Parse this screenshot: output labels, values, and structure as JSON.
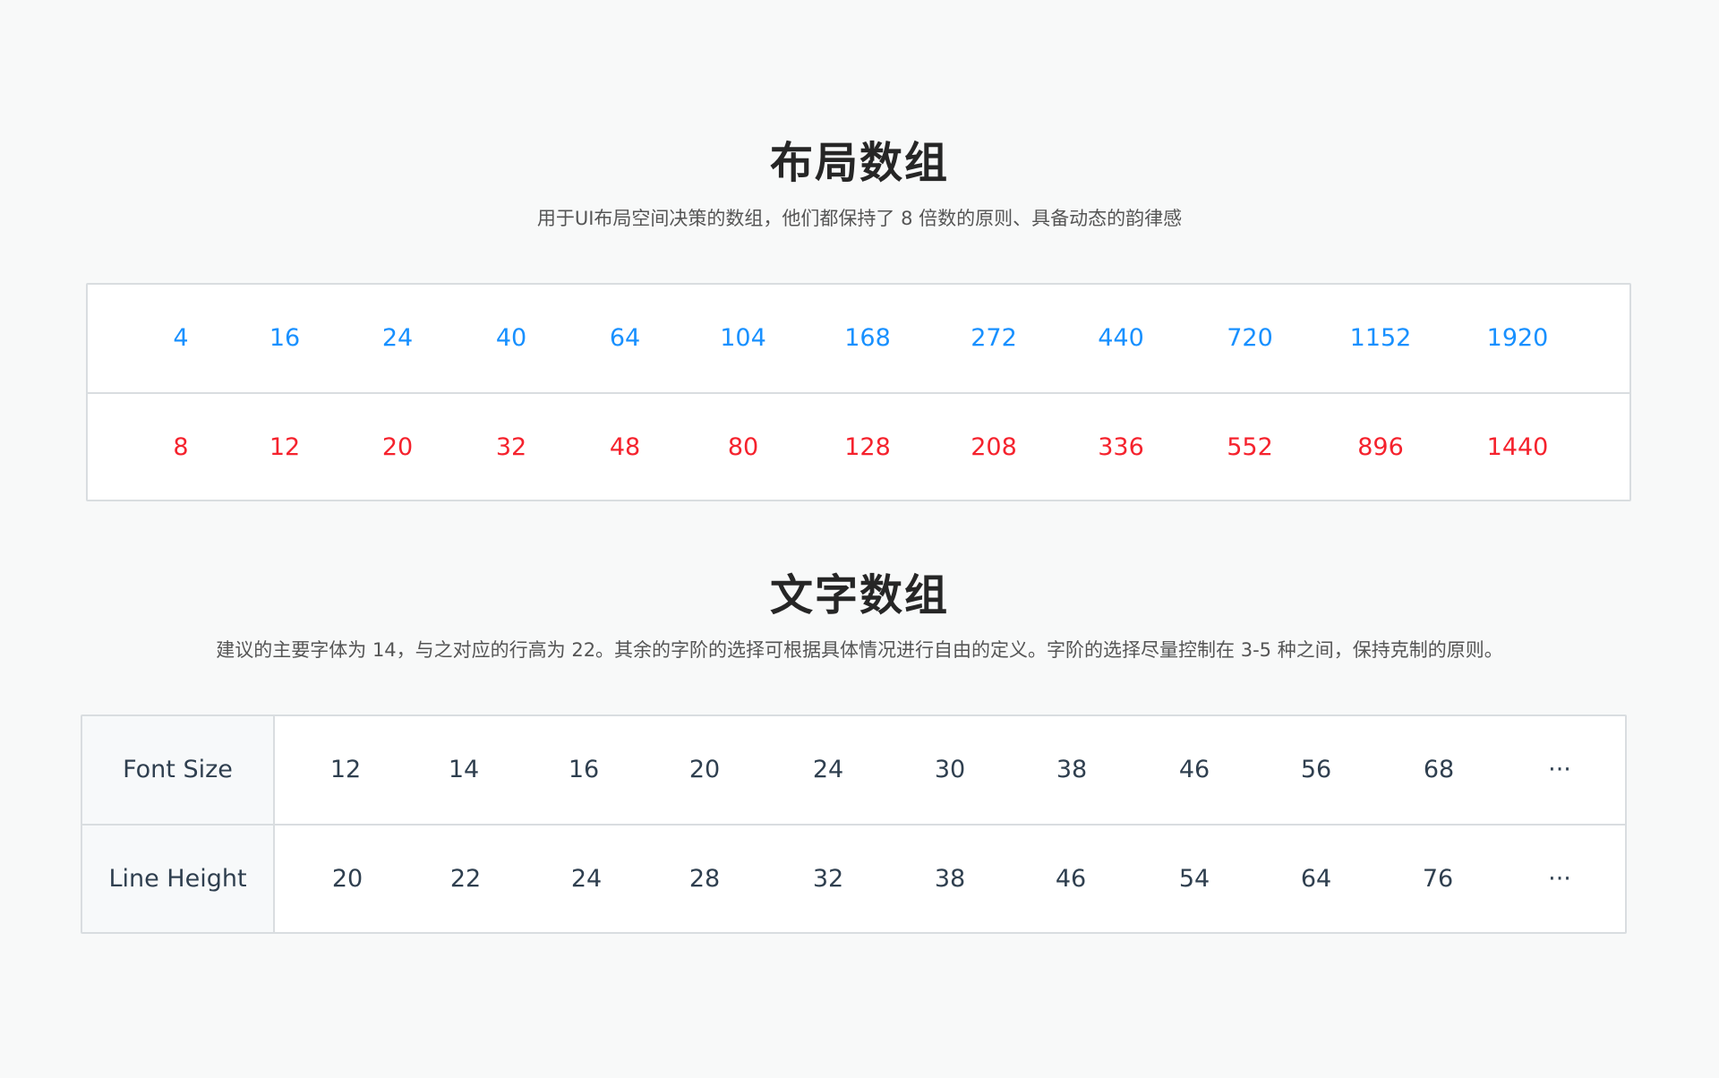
{
  "layout_section": {
    "title": "布局数组",
    "description": "用于UI布局空间决策的数组，他们都保持了 8 倍数的原则、具备动态的韵律感",
    "row_1": [
      "4",
      "16",
      "24",
      "40",
      "64",
      "104",
      "168",
      "272",
      "440",
      "720",
      "1152",
      "1920"
    ],
    "row_2": [
      "8",
      "12",
      "20",
      "32",
      "48",
      "80",
      "128",
      "208",
      "336",
      "552",
      "896",
      "1440"
    ],
    "colors": {
      "row_1": "#1890ff",
      "row_2": "#f5222d"
    }
  },
  "text_section": {
    "title": "文字数组",
    "description": "建议的主要字体为 14，与之对应的行高为 22。其余的字阶的选择可根据具体情况进行自由的定义。字阶的选择尽量控制在 3-5 种之间，保持克制的原则。",
    "font_size_label": "Font Size",
    "line_height_label": "Line Height",
    "font_sizes": [
      "12",
      "14",
      "16",
      "20",
      "24",
      "30",
      "38",
      "46",
      "56",
      "68",
      "···"
    ],
    "line_heights": [
      "20",
      "22",
      "24",
      "28",
      "32",
      "38",
      "46",
      "54",
      "64",
      "76",
      "···"
    ]
  }
}
